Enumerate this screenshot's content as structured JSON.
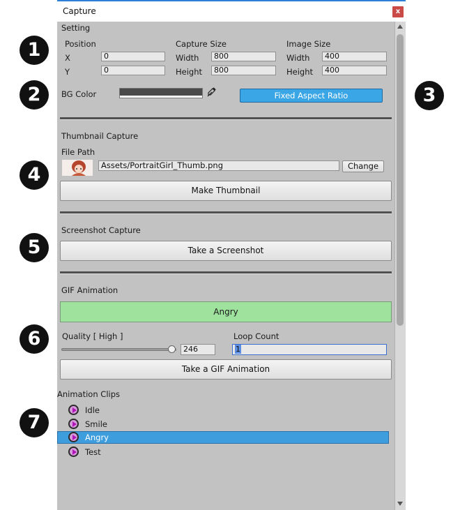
{
  "window": {
    "title": "Capture",
    "close_label": "x"
  },
  "badges": [
    "1",
    "2",
    "3",
    "4",
    "5",
    "6",
    "7"
  ],
  "setting": {
    "header": "Setting",
    "position": {
      "label": "Position",
      "x_label": "X",
      "x_value": "0",
      "y_label": "Y",
      "y_value": "0"
    },
    "capture_size": {
      "label": "Capture Size",
      "width_label": "Width",
      "width_value": "800",
      "height_label": "Height",
      "height_value": "800"
    },
    "image_size": {
      "label": "Image Size",
      "width_label": "Width",
      "width_value": "400",
      "height_label": "Height",
      "height_value": "400"
    },
    "bg_color_label": "BG Color",
    "bg_color": "#4a4a4a",
    "fixed_aspect_ratio_label": "Fixed Aspect Ratio"
  },
  "thumbnail": {
    "header": "Thumbnail Capture",
    "file_path_label": "File Path",
    "file_path_value": "Assets/PortraitGirl_Thumb.png",
    "change_label": "Change",
    "make_label": "Make Thumbnail"
  },
  "screenshot": {
    "header": "Screenshot Capture",
    "take_label": "Take a Screenshot"
  },
  "gif": {
    "header": "GIF Animation",
    "selected_clip": "Angry",
    "quality_label": "Quality [ High ]",
    "quality_value": "246",
    "quality_level": 246,
    "loop_count_label": "Loop Count",
    "loop_count_value": "1",
    "take_label": "Take a GIF Animation"
  },
  "clips": {
    "header": "Animation Clips",
    "items": [
      {
        "name": "Idle"
      },
      {
        "name": "Smile"
      },
      {
        "name": "Angry"
      },
      {
        "name": "Test"
      }
    ],
    "selected_index": 2
  },
  "colors": {
    "accent": "#3d9ddd",
    "gif_clip_bg": "#9ee29e",
    "window_bg": "#c2c2c2",
    "close": "#c94a47"
  }
}
